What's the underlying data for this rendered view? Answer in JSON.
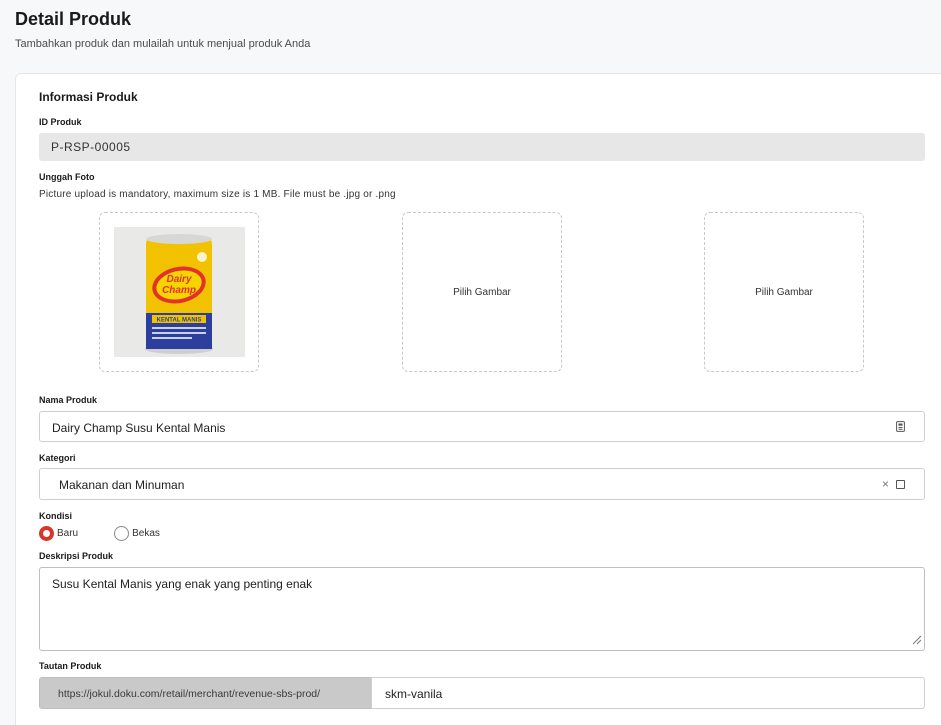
{
  "header": {
    "title": "Detail Produk",
    "subtitle": "Tambahkan produk dan mulailah untuk menjual produk Anda"
  },
  "section": {
    "title": "Informasi Produk"
  },
  "product_id": {
    "label": "ID Produk",
    "value": "P-RSP-00005"
  },
  "photo_upload": {
    "label": "Unggah Foto",
    "hint": "Picture upload is mandatory, maximum size is 1 MB. File must be .jpg or .png",
    "photo_brand_text": "Dairy Champ",
    "photo_product_text": "KENTAL MANIS",
    "slot_2_label": "Pilih Gambar",
    "slot_3_label": "Pilih Gambar"
  },
  "product_name": {
    "label": "Nama Produk",
    "value": "Dairy Champ Susu Kental Manis"
  },
  "category": {
    "label": "Kategori",
    "value": "Makanan dan Minuman",
    "clear_symbol": "×"
  },
  "condition": {
    "label": "Kondisi",
    "options": [
      {
        "label": "Baru",
        "selected": true
      },
      {
        "label": "Bekas",
        "selected": false
      }
    ]
  },
  "description": {
    "label": "Deskripsi Produk",
    "value": "Susu Kental Manis yang enak yang penting enak"
  },
  "product_link": {
    "label": "Tautan Produk",
    "prefix": "https://jokul.doku.com/retail/merchant/revenue-sbs-prod/",
    "slug": "skm-vanila"
  },
  "colors": {
    "accent_radio": "#d8362a",
    "readonly_bg": "#e7e7e7",
    "prefix_bg": "#c9c9c9"
  }
}
